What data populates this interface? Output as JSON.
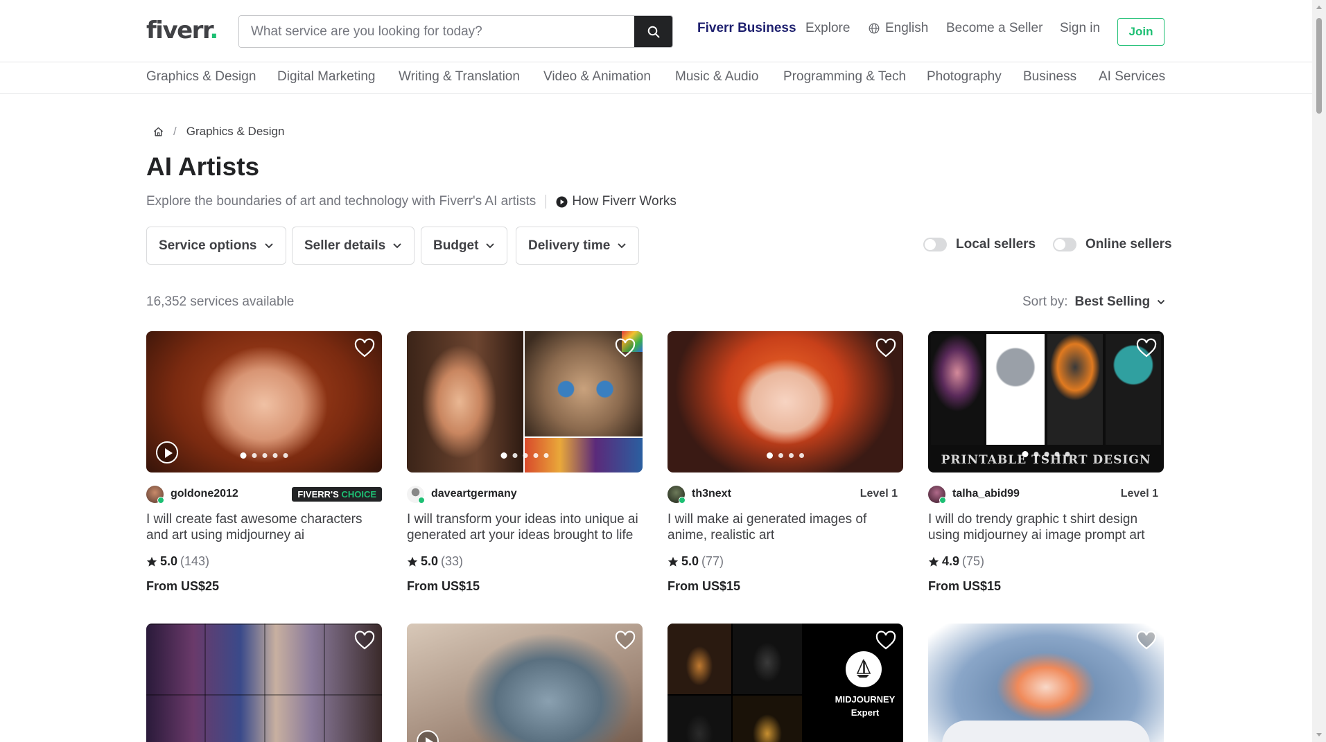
{
  "header": {
    "logo_text": "fiverr",
    "logo_dot": ".",
    "search_placeholder": "What service are you looking for today?",
    "nav": {
      "business": "Fiverr Business",
      "explore": "Explore",
      "language": "English",
      "become_seller": "Become a Seller",
      "sign_in": "Sign in",
      "join": "Join"
    }
  },
  "categories": [
    "Graphics & Design",
    "Digital Marketing",
    "Writing & Translation",
    "Video & Animation",
    "Music & Audio",
    "Programming & Tech",
    "Photography",
    "Business",
    "AI Services"
  ],
  "breadcrumb": {
    "current": "Graphics & Design",
    "separator": "/"
  },
  "page": {
    "title": "AI Artists",
    "subtitle": "Explore the boundaries of art and technology with Fiverr's AI artists",
    "how_link": "How Fiverr Works"
  },
  "filters": {
    "service_options": "Service options",
    "seller_details": "Seller details",
    "budget": "Budget",
    "delivery_time": "Delivery time",
    "local_sellers": "Local sellers",
    "online_sellers": "Online sellers"
  },
  "results": {
    "count": "16,352 services available",
    "sort_label": "Sort by:",
    "sort_value": "Best Selling"
  },
  "gigs": [
    {
      "seller": "goldone2012",
      "badge_a": "FIVERR'S",
      "badge_b": "CHOICE",
      "title": "I will create fast awesome characters and art using midjourney ai",
      "rating": "5.0",
      "reviews": "(143)",
      "price": "From US$25"
    },
    {
      "seller": "daveartgermany",
      "title": "I will transform your ideas into unique ai generated art your ideas brought to life",
      "rating": "5.0",
      "reviews": "(33)",
      "price": "From US$15"
    },
    {
      "seller": "th3next",
      "level": "Level 1",
      "title": "I will make ai generated images of anime, realistic art",
      "rating": "5.0",
      "reviews": "(77)",
      "price": "From US$15"
    },
    {
      "seller": "talha_abid99",
      "level": "Level 1",
      "title": "I will do trendy graphic t shirt design using midjourney ai image prompt art",
      "rating": "4.9",
      "reviews": "(75)",
      "price": "From US$15",
      "thumb_text": "PRINTABLE TSHIRT DESIGN"
    }
  ],
  "row2": {
    "midjourney_line1": "MIDJOURNEY",
    "midjourney_line2": "Expert"
  }
}
